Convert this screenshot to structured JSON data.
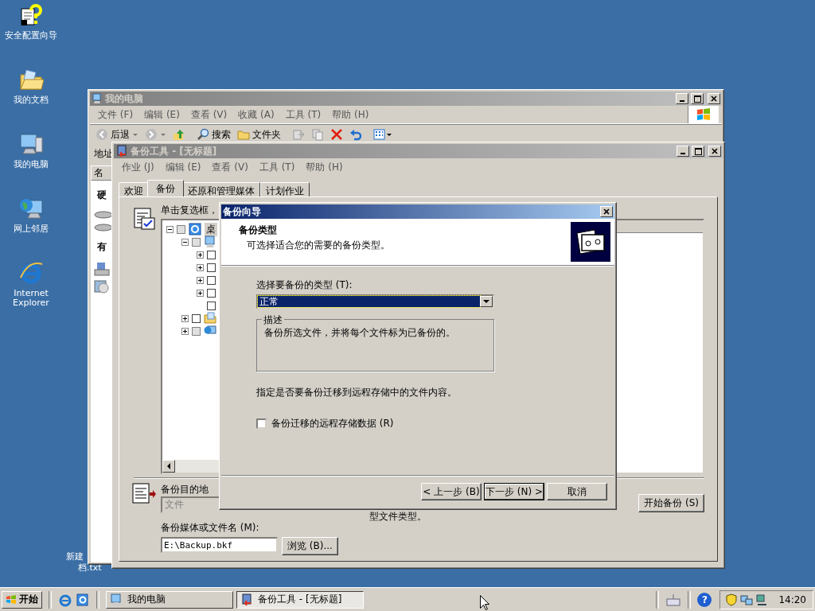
{
  "desktop_icons": [
    {
      "label": "安全配置向导",
      "kind": "wizard"
    },
    {
      "label": "我的文档",
      "kind": "documents"
    },
    {
      "label": "我的电脑",
      "kind": "computer"
    },
    {
      "label": "网上邻居",
      "kind": "network"
    },
    {
      "label": "Internet Explorer",
      "kind": "browser"
    }
  ],
  "partial_desktop_icon": {
    "label_line_1": "新建",
    "label_line_2": "档.txt"
  },
  "explorer_window": {
    "title": "我的电脑",
    "active": false,
    "menu": [
      "文件 (F)",
      "编辑 (E)",
      "查看 (V)",
      "收藏 (A)",
      "工具 (T)",
      "帮助 (H)"
    ],
    "toolbar": [
      {
        "kind": "back",
        "label": "后退"
      },
      {
        "kind": "forward"
      },
      {
        "kind": "up"
      },
      {
        "kind": "search",
        "label": "搜索"
      },
      {
        "kind": "folders",
        "label": "文件夹"
      },
      {
        "kind": "move"
      },
      {
        "kind": "copy"
      },
      {
        "kind": "delete"
      },
      {
        "kind": "undo"
      },
      {
        "kind": "views"
      }
    ],
    "address_label": "地址",
    "column_1": "名",
    "left_pane_texts": [
      "硬",
      "有"
    ]
  },
  "backup_window": {
    "title": "备份工具 - [无标题]",
    "active": false,
    "menu": [
      "作业 (J)",
      "编辑 (E)",
      "查看 (V)",
      "工具 (T)",
      "帮助 (H)"
    ],
    "tabs": [
      {
        "label": "欢迎",
        "selected": false
      },
      {
        "label": "备份",
        "selected": true
      },
      {
        "label": "还原和管理媒体",
        "selected": false
      },
      {
        "label": "计划作业",
        "selected": false
      }
    ],
    "instruction": "单击复选框，",
    "tree": [
      {
        "label": "桌",
        "mixed": true,
        "expanded": true,
        "kind": "desktop",
        "children": [
          {
            "mixed": true,
            "expanded": true,
            "kind": "computer",
            "children": [
              {
                "mixed": false,
                "expanded": false
              },
              {
                "mixed": false,
                "expanded": false
              },
              {
                "mixed": false,
                "expanded": false
              },
              {
                "mixed": false,
                "expanded": false
              },
              {
                "mixed": false
              }
            ]
          },
          {
            "mixed": false,
            "expanded": false,
            "kind": "documents"
          },
          {
            "mixed": true,
            "expanded": false,
            "kind": "network"
          }
        ]
      }
    ],
    "destination_label": "备份目的地",
    "destination_type": {
      "value": "文件",
      "disabled": true
    },
    "hint_fragment": "型文件类型。",
    "media_label": "备份媒体或文件名 (M):",
    "media_path": "E:\\Backup.bkf",
    "browse_button": "浏览 (B)...",
    "start_button": "开始备份 (S)"
  },
  "wizard_dialog": {
    "title": "备份向导",
    "heading": "备份类型",
    "subheading": "可选择适合您的需要的备份类型。",
    "type_label": "选择要备份的类型 (T):",
    "type_value": "正常",
    "description_title": "描述",
    "description": "备份所选文件，并将每个文件标为已备份的。",
    "remote_note": "指定是否要备份迁移到远程存储中的文件内容。",
    "remote_checkbox": {
      "label": "备份迁移的远程存储数据 (R)",
      "checked": false
    },
    "buttons": [
      {
        "label": "< 上一步 (B)",
        "default": false
      },
      {
        "label": "下一步 (N) >",
        "default": true
      },
      {
        "label": "取消",
        "default": false
      }
    ]
  },
  "taskbar": {
    "start_label": "开始",
    "quick_launch": [
      {
        "kind": "browser"
      },
      {
        "kind": "page"
      }
    ],
    "tasks": [
      {
        "label": "我的电脑",
        "kind": "computer",
        "selected": false
      },
      {
        "label": "备份工具 - [无标题]",
        "kind": "backup",
        "selected": true
      }
    ],
    "help_glyph": "?",
    "clock": "14:20"
  }
}
